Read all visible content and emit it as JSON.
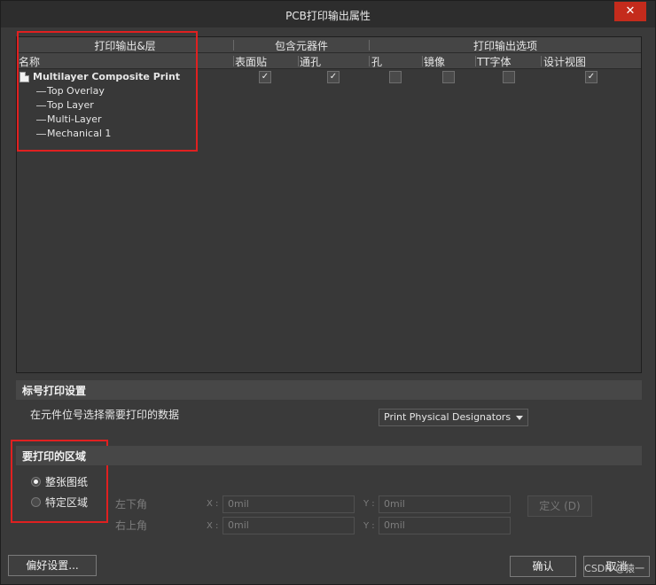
{
  "window": {
    "title": "PCB打印输出属性",
    "close_glyph": "✕"
  },
  "grid": {
    "group_headers": {
      "layers": "打印输出&层",
      "components": "包含元器件",
      "options": "打印输出选项"
    },
    "columns": {
      "name": "名称",
      "smd": "表面贴",
      "through_hole": "通孔",
      "holes": "孔",
      "mirror": "镜像",
      "tt_font": "TT字体",
      "design_view": "设计视图"
    },
    "printout": {
      "label": "Multilayer Composite Print",
      "smd": true,
      "through_hole": true,
      "holes": false,
      "mirror": false,
      "tt_font": false,
      "design_view": true
    },
    "layers": [
      "Top Overlay",
      "Top Layer",
      "Multi-Layer",
      "Mechanical 1"
    ]
  },
  "designator_section": {
    "title": "标号打印设置",
    "prompt": "在元件位号选择需要打印的数据",
    "combo_value": "Print Physical Designators"
  },
  "area_section": {
    "title": "要打印的区域",
    "option_whole": "整张图纸",
    "option_specific": "特定区域",
    "selected": "整张图纸",
    "lower_left": "左下角",
    "upper_right": "右上角",
    "x_label": "X :",
    "y_label": "Y :",
    "ll_x": "0mil",
    "ll_y": "0mil",
    "ur_x": "0mil",
    "ur_y": "0mil",
    "define_button": "定义 (D)"
  },
  "footer": {
    "preferences_button": "偏好设置...",
    "ok_button": "确认",
    "cancel_button": "取消",
    "watermark": "CSDN @猿一"
  },
  "colors": {
    "highlight_box": "#e02020",
    "window_bg": "#3a3a3a",
    "close_button": "#c42b1c"
  }
}
